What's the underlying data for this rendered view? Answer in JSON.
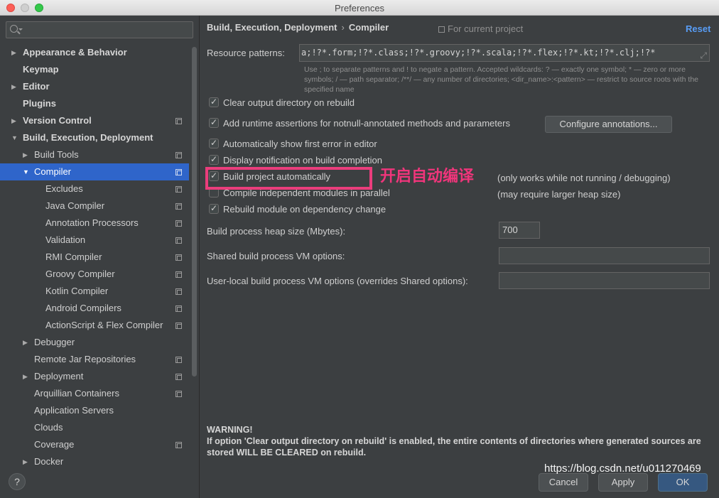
{
  "window": {
    "title": "Preferences"
  },
  "sidebar": {
    "search_placeholder": "",
    "items": [
      {
        "label": "Appearance & Behavior",
        "bold": true,
        "arrow": "▶",
        "copy": false
      },
      {
        "label": "Keymap",
        "bold": true,
        "arrow": "",
        "copy": false
      },
      {
        "label": "Editor",
        "bold": true,
        "arrow": "▶",
        "copy": false
      },
      {
        "label": "Plugins",
        "bold": true,
        "arrow": "",
        "copy": false
      },
      {
        "label": "Version Control",
        "bold": true,
        "arrow": "▶",
        "copy": true
      },
      {
        "label": "Build, Execution, Deployment",
        "bold": true,
        "arrow": "▼",
        "copy": false
      },
      {
        "label": "Build Tools",
        "bold": false,
        "arrow": "▶",
        "copy": true
      },
      {
        "label": "Compiler",
        "bold": false,
        "arrow": "▼",
        "copy": true,
        "selected": true
      },
      {
        "label": "Excludes",
        "bold": false,
        "arrow": "",
        "copy": true
      },
      {
        "label": "Java Compiler",
        "bold": false,
        "arrow": "",
        "copy": true
      },
      {
        "label": "Annotation Processors",
        "bold": false,
        "arrow": "",
        "copy": true
      },
      {
        "label": "Validation",
        "bold": false,
        "arrow": "",
        "copy": true
      },
      {
        "label": "RMI Compiler",
        "bold": false,
        "arrow": "",
        "copy": true
      },
      {
        "label": "Groovy Compiler",
        "bold": false,
        "arrow": "",
        "copy": true
      },
      {
        "label": "Kotlin Compiler",
        "bold": false,
        "arrow": "",
        "copy": true
      },
      {
        "label": "Android Compilers",
        "bold": false,
        "arrow": "",
        "copy": true
      },
      {
        "label": "ActionScript & Flex Compiler",
        "bold": false,
        "arrow": "",
        "copy": true
      },
      {
        "label": "Debugger",
        "bold": false,
        "arrow": "▶",
        "copy": false
      },
      {
        "label": "Remote Jar Repositories",
        "bold": false,
        "arrow": "",
        "copy": true
      },
      {
        "label": "Deployment",
        "bold": false,
        "arrow": "▶",
        "copy": true
      },
      {
        "label": "Arquillian Containers",
        "bold": false,
        "arrow": "",
        "copy": true
      },
      {
        "label": "Application Servers",
        "bold": false,
        "arrow": "",
        "copy": false
      },
      {
        "label": "Clouds",
        "bold": false,
        "arrow": "",
        "copy": false
      },
      {
        "label": "Coverage",
        "bold": false,
        "arrow": "",
        "copy": true
      },
      {
        "label": "Docker",
        "bold": false,
        "arrow": "▶",
        "copy": false
      }
    ],
    "help_label": "?"
  },
  "header": {
    "crumb_parent": "Build, Execution, Deployment",
    "crumb_sep": "›",
    "crumb_current": "Compiler",
    "for_current_project": "For current project",
    "reset_label": "Reset"
  },
  "resource": {
    "label": "Resource patterns:",
    "value": "a;!?*.form;!?*.class;!?*.groovy;!?*.scala;!?*.flex;!?*.kt;!?*.clj;!?*",
    "hint": "Use ; to separate patterns and ! to negate a pattern. Accepted wildcards: ? — exactly one symbol; * — zero or more symbols; / — path separator; /**/ — any number of directories; <dir_name>:<pattern> — restrict to source roots with the specified name"
  },
  "options": {
    "clear_output": {
      "label": "Clear output directory on rebuild",
      "checked": true
    },
    "add_assertions": {
      "label": "Add runtime assertions for notnull-annotated methods and parameters",
      "checked": true
    },
    "configure_annotations": "Configure annotations...",
    "show_first_error": {
      "label": "Automatically show first error in editor",
      "checked": true
    },
    "display_notification": {
      "label": "Display notification on build completion",
      "checked": true
    },
    "build_automatically": {
      "label": "Build project automatically",
      "checked": true,
      "note": "(only works while not running / debugging)"
    },
    "compile_parallel": {
      "label": "Compile independent modules in parallel",
      "checked": false,
      "note": "(may require larger heap size)"
    },
    "rebuild_on_dependency": {
      "label": "Rebuild module on dependency change",
      "checked": true
    }
  },
  "heap": {
    "label": "Build process heap size (Mbytes):",
    "value": "700"
  },
  "shared_vm": {
    "label": "Shared build process VM options:",
    "value": ""
  },
  "user_vm": {
    "label": "User-local build process VM options (overrides Shared options):",
    "value": ""
  },
  "annotation_text": "开启自动编译",
  "warning": {
    "title": "WARNING!",
    "body": "If option 'Clear output directory on rebuild' is enabled, the entire contents of directories where generated sources are stored WILL BE CLEARED on rebuild."
  },
  "footer": {
    "cancel": "Cancel",
    "apply": "Apply",
    "ok": "OK"
  },
  "watermark": "https://blog.csdn.net/u011270469",
  "colors": {
    "accent": "#2f65ca",
    "link": "#589df6",
    "annotation": "#ea3d7c",
    "background": "#3c3f41"
  }
}
